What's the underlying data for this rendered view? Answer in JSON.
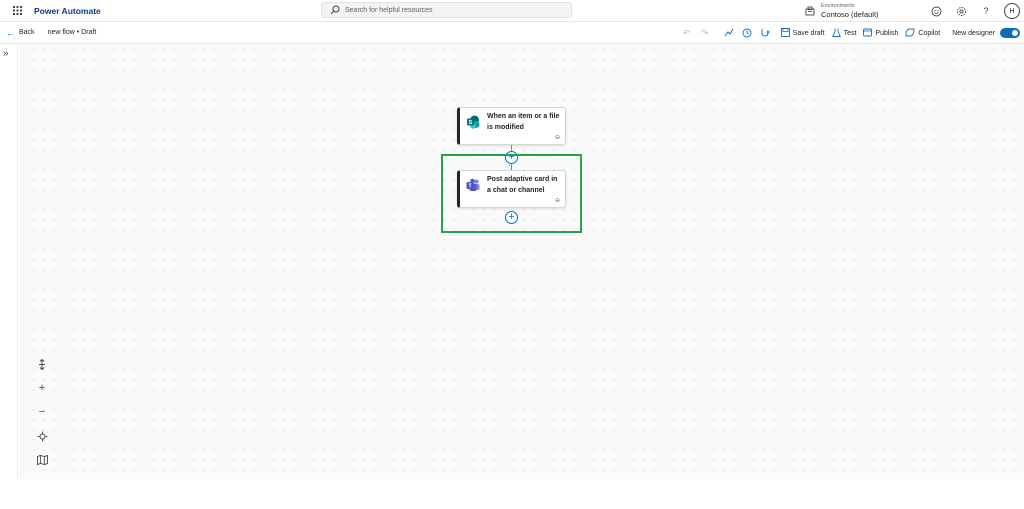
{
  "app": {
    "title": "Power Automate"
  },
  "search": {
    "placeholder": "Search for helpful resources"
  },
  "environment": {
    "label": "Environments",
    "name": "Contoso (default)"
  },
  "user": {
    "initial": "H"
  },
  "command_bar": {
    "back_label": "Back",
    "flow_name": "new flow • Draft",
    "save_label": "Save draft",
    "test_label": "Test",
    "publish_label": "Publish",
    "copilot_label": "Copilot",
    "new_designer_label": "New designer",
    "new_designer_on": true
  },
  "flow": {
    "trigger": {
      "title": "When an item or a file is modified",
      "icon": "sharepoint-icon"
    },
    "action": {
      "title": "Post adaptive card in a chat or channel",
      "icon": "teams-icon"
    }
  },
  "colors": {
    "accent": "#0f6cbd",
    "highlight": "#22a447",
    "sharepoint": "#038387",
    "teams": "#5b5fc7"
  }
}
